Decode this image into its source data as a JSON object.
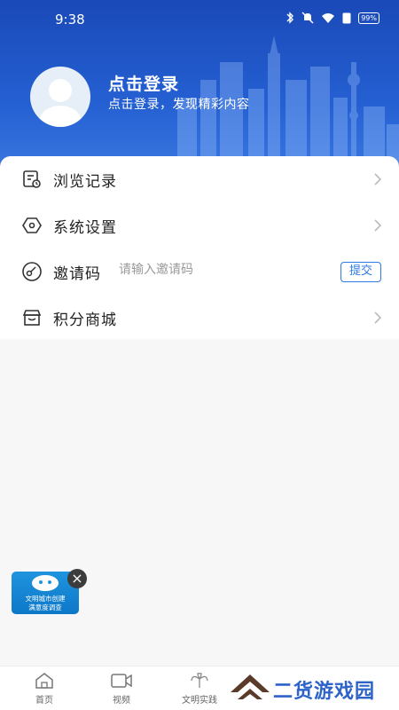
{
  "status_bar": {
    "time": "9:38",
    "battery_label": "99%"
  },
  "profile": {
    "title": "点击登录",
    "subtitle": "点击登录，发现精彩内容"
  },
  "menu": {
    "history_label": "浏览记录",
    "settings_label": "系统设置",
    "invite_label": "邀请码",
    "invite_placeholder": "请输入邀请码",
    "invite_value": "",
    "submit_label": "提交",
    "points_mall_label": "积分商城"
  },
  "float_badge": {
    "line1": "文明城市创建",
    "line2": "满意度调查"
  },
  "bottom_nav": {
    "home": "首页",
    "video": "视频",
    "practice": "文明实践"
  },
  "watermark": {
    "text": "二货游戏园"
  },
  "colors": {
    "header_blue": "#1a49b8",
    "accent": "#2d79e6",
    "badge_blue": "#1f94de",
    "watermark": "#2d63c8"
  }
}
